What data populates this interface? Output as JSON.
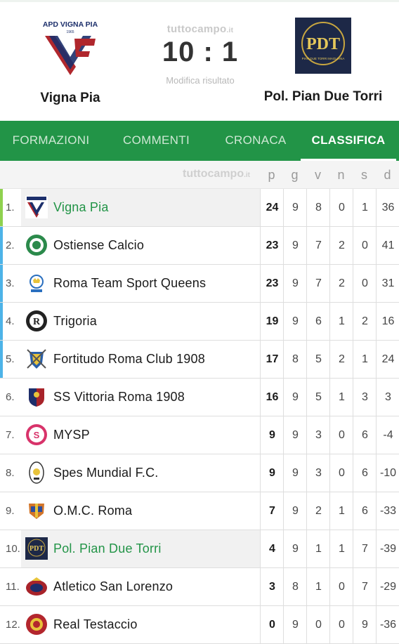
{
  "match": {
    "home": {
      "name": "Vigna Pia",
      "logo_text_top": "APD VIGNA PIA",
      "logo_text_year": "1965"
    },
    "away": {
      "name": "Pol. Pian Due Torri",
      "logo_text": "PDT",
      "logo_text_sub": "PIAN DUE TORRI MAGLIANA"
    },
    "brand": "tuttocampo",
    "brand_suffix": ".it",
    "score": "10 : 1",
    "edit_link": "Modifica risultato"
  },
  "tabs": [
    {
      "label": "FORMAZIONI",
      "active": false
    },
    {
      "label": "COMMENTI",
      "active": false
    },
    {
      "label": "CRONACA",
      "active": false
    },
    {
      "label": "CLASSIFICA",
      "active": true
    }
  ],
  "standings": {
    "watermark": "tuttocampo",
    "watermark_suffix": ".it",
    "columns": [
      "p",
      "g",
      "v",
      "n",
      "s",
      "d"
    ],
    "rows": [
      {
        "pos": "1.",
        "team": "Vigna Pia",
        "p": "24",
        "g": "9",
        "v": "8",
        "n": "0",
        "s": "1",
        "d": "36",
        "highlight": true,
        "marker": "#8fd14f",
        "crest": "vignapia"
      },
      {
        "pos": "2.",
        "team": "Ostiense Calcio",
        "p": "23",
        "g": "9",
        "v": "7",
        "n": "2",
        "s": "0",
        "d": "41",
        "highlight": false,
        "marker": "#4db3e8",
        "crest": "green-ring"
      },
      {
        "pos": "3.",
        "team": "Roma Team Sport Queens",
        "p": "23",
        "g": "9",
        "v": "7",
        "n": "2",
        "s": "0",
        "d": "31",
        "highlight": false,
        "marker": "#4db3e8",
        "crest": "queens"
      },
      {
        "pos": "4.",
        "team": "Trigoria",
        "p": "19",
        "g": "9",
        "v": "6",
        "n": "1",
        "s": "2",
        "d": "16",
        "highlight": false,
        "marker": "#4db3e8",
        "crest": "trigoria"
      },
      {
        "pos": "5.",
        "team": "Fortitudo Roma Club 1908",
        "p": "17",
        "g": "8",
        "v": "5",
        "n": "2",
        "s": "1",
        "d": "24",
        "highlight": false,
        "marker": "#4db3e8",
        "crest": "fortitudo"
      },
      {
        "pos": "6.",
        "team": "SS Vittoria Roma 1908",
        "p": "16",
        "g": "9",
        "v": "5",
        "n": "1",
        "s": "3",
        "d": "3",
        "highlight": false,
        "marker": "",
        "crest": "vittoria"
      },
      {
        "pos": "7.",
        "team": "MYSP",
        "p": "9",
        "g": "9",
        "v": "3",
        "n": "0",
        "s": "6",
        "d": "-4",
        "highlight": false,
        "marker": "",
        "crest": "mysp"
      },
      {
        "pos": "8.",
        "team": "Spes Mundial F.C.",
        "p": "9",
        "g": "9",
        "v": "3",
        "n": "0",
        "s": "6",
        "d": "-10",
        "highlight": false,
        "marker": "",
        "crest": "spes"
      },
      {
        "pos": "9.",
        "team": "O.M.C. Roma",
        "p": "7",
        "g": "9",
        "v": "2",
        "n": "1",
        "s": "6",
        "d": "-33",
        "highlight": false,
        "marker": "",
        "crest": "omc"
      },
      {
        "pos": "10.",
        "team": "Pol. Pian Due Torri",
        "p": "4",
        "g": "9",
        "v": "1",
        "n": "1",
        "s": "7",
        "d": "-39",
        "highlight": true,
        "marker": "",
        "crest": "pdt"
      },
      {
        "pos": "11.",
        "team": "Atletico San Lorenzo",
        "p": "3",
        "g": "8",
        "v": "1",
        "n": "0",
        "s": "7",
        "d": "-29",
        "highlight": false,
        "marker": "",
        "crest": "sanlorenzo"
      },
      {
        "pos": "12.",
        "team": "Real Testaccio",
        "p": "0",
        "g": "9",
        "v": "0",
        "n": "0",
        "s": "9",
        "d": "-36",
        "highlight": false,
        "marker": "",
        "crest": "testaccio"
      }
    ]
  },
  "colors": {
    "accent": "#229447",
    "leader_marker": "#8fd14f",
    "promo_marker": "#4db3e8",
    "highlight_text": "#229447"
  }
}
